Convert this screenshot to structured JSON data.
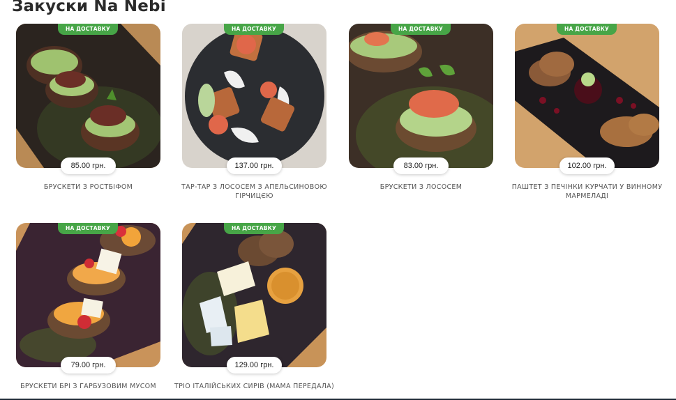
{
  "section": {
    "title": "Закуски Na Nebi"
  },
  "badge_label": "НА ДОСТАВКУ",
  "colors": {
    "badge": "#47a547",
    "title": "#2a2a2a",
    "bottom_rule": "#1f2a36"
  },
  "products": [
    {
      "name": "БРУСКЕТИ З РОСТБІФОМ",
      "price": "85.00 грн."
    },
    {
      "name": "ТАР-ТАР З ЛОСОСЕМ З АПЕЛЬСИНОВОЮ ГІРЧИЦЄЮ",
      "price": "137.00 грн."
    },
    {
      "name": "БРУСКЕТИ З ЛОСОСЕМ",
      "price": "83.00 грн."
    },
    {
      "name": "ПАШТЕТ З ПЕЧІНКИ КУРЧАТИ У ВИННОМУ МАРМЕЛАДІ",
      "price": "102.00 грн."
    },
    {
      "name": "БРУСКЕТИ БРІ З ГАРБУЗОВИМ МУСОМ",
      "price": "79.00 грн."
    },
    {
      "name": "ТРІО ІТАЛІЙСЬКИХ СИРІВ (МАМА ПЕРЕДАЛА)",
      "price": "129.00 грн."
    }
  ]
}
